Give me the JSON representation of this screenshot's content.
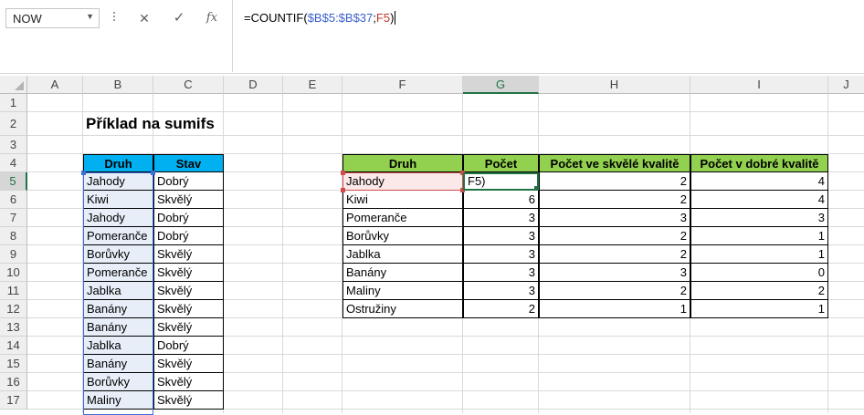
{
  "formula_bar": {
    "name_box": "NOW",
    "cancel_glyph": "✕",
    "enter_glyph": "✓",
    "fx_glyph": "fx",
    "formula_prefix": "=COUNTIF(",
    "formula_range": "$B$5:$B$37",
    "formula_sep": ";",
    "formula_crit": "F5",
    "formula_close": ")"
  },
  "columns": [
    "A",
    "B",
    "C",
    "D",
    "E",
    "F",
    "G",
    "H",
    "I",
    "J"
  ],
  "rows": [
    "1",
    "2",
    "3",
    "4",
    "5",
    "6",
    "7",
    "8",
    "9",
    "10",
    "11",
    "12",
    "13",
    "14",
    "15",
    "16",
    "17"
  ],
  "active_column": "G",
  "active_row": "5",
  "sheet": {
    "title": "Příklad na sumifs",
    "left_table": {
      "headers": [
        "Druh",
        "Stav"
      ],
      "rows": [
        [
          "Jahody",
          "Dobrý"
        ],
        [
          "Kiwi",
          "Skvělý"
        ],
        [
          "Jahody",
          "Dobrý"
        ],
        [
          "Pomeranče",
          "Dobrý"
        ],
        [
          "Borůvky",
          "Skvělý"
        ],
        [
          "Pomeranče",
          "Skvělý"
        ],
        [
          "Jablka",
          "Skvělý"
        ],
        [
          "Banány",
          "Skvělý"
        ],
        [
          "Banány",
          "Skvělý"
        ],
        [
          "Jablka",
          "Dobrý"
        ],
        [
          "Banány",
          "Skvělý"
        ],
        [
          "Borůvky",
          "Skvělý"
        ],
        [
          "Maliny",
          "Skvělý"
        ]
      ]
    },
    "right_table": {
      "headers": [
        "Druh",
        "Počet",
        "Počet ve skvělé kvalitě",
        "Počet v dobré kvalitě"
      ],
      "editing_cell_text": "F5)",
      "rows": [
        [
          "Jahody",
          "",
          "2",
          "4"
        ],
        [
          "Kiwi",
          "6",
          "2",
          "4"
        ],
        [
          "Pomeranče",
          "3",
          "3",
          "3"
        ],
        [
          "Borůvky",
          "3",
          "2",
          "1"
        ],
        [
          "Jablka",
          "3",
          "2",
          "1"
        ],
        [
          "Banány",
          "3",
          "3",
          "0"
        ],
        [
          "Maliny",
          "3",
          "2",
          "2"
        ],
        [
          "Ostružiny",
          "2",
          "1",
          "1"
        ]
      ]
    }
  },
  "colors": {
    "header_blue": "#00b0f0",
    "header_green": "#92d050",
    "range_blue": "#3a6fd8",
    "range_red": "#d04b4b",
    "excel_green": "#217346"
  }
}
